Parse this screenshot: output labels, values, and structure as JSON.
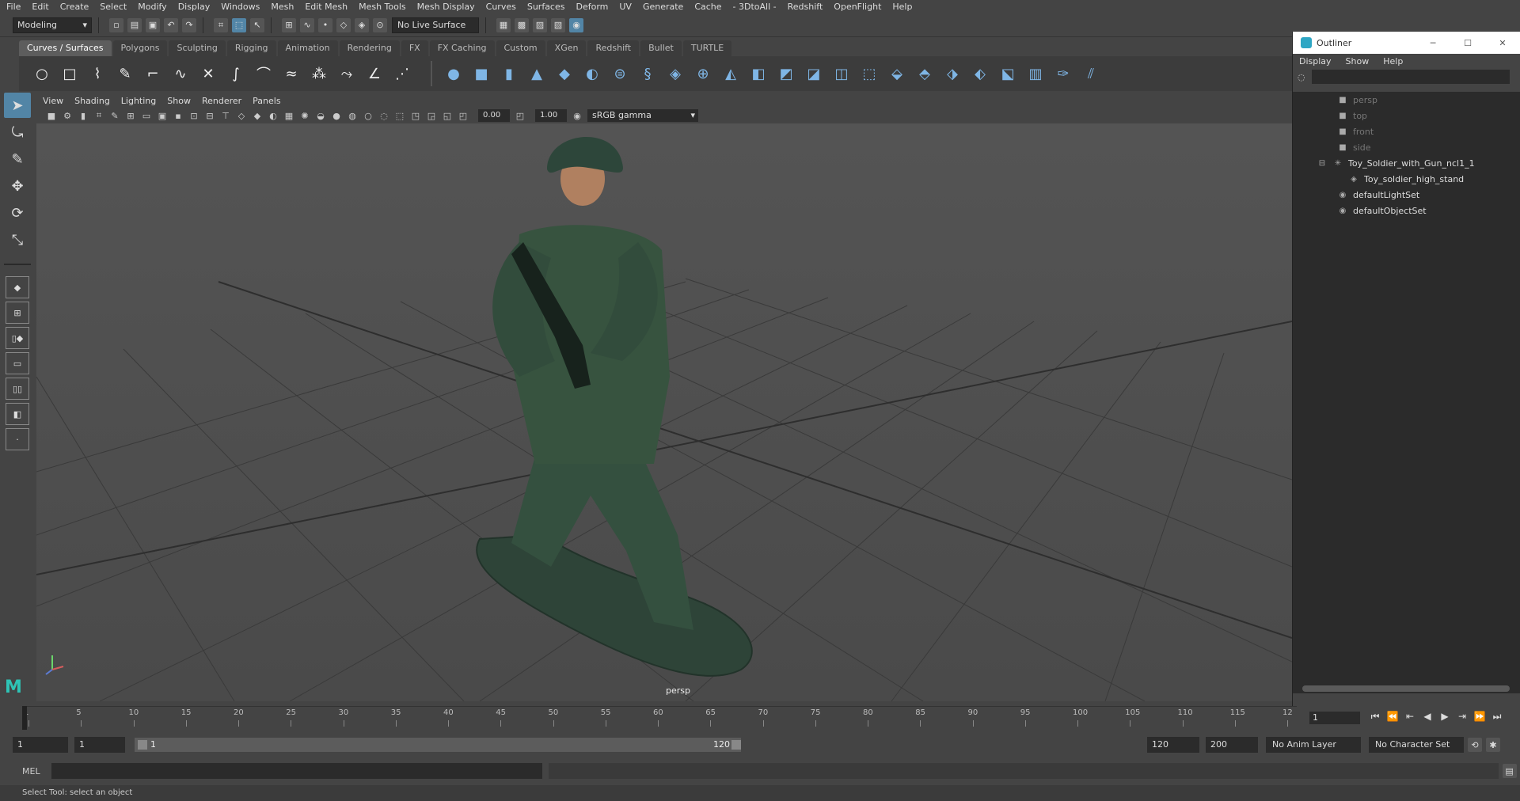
{
  "menubar": [
    "File",
    "Edit",
    "Create",
    "Select",
    "Modify",
    "Display",
    "Windows",
    "Mesh",
    "Edit Mesh",
    "Mesh Tools",
    "Mesh Display",
    "Curves",
    "Surfaces",
    "Deform",
    "UV",
    "Generate",
    "Cache",
    "- 3DtoAll -",
    "Redshift",
    "OpenFlight",
    "Help"
  ],
  "statusline": {
    "mode": "Modeling",
    "live_surface": "No Live Surface"
  },
  "shelf_tabs": [
    "Curves / Surfaces",
    "Polygons",
    "Sculpting",
    "Rigging",
    "Animation",
    "Rendering",
    "FX",
    "FX Caching",
    "Custom",
    "XGen",
    "Redshift",
    "Bullet",
    "TURTLE"
  ],
  "active_shelf": "Curves / Surfaces",
  "panel_menu": [
    "View",
    "Shading",
    "Lighting",
    "Show",
    "Renderer",
    "Panels"
  ],
  "panel_toolbar": {
    "exposure": "0.00",
    "gamma": "1.00",
    "color_space": "sRGB gamma"
  },
  "viewport": {
    "camera_label": "persp"
  },
  "outliner": {
    "title": "Outliner",
    "menu": [
      "Display",
      "Show",
      "Help"
    ],
    "items": [
      {
        "label": "persp",
        "icon": "camera-icon",
        "dim": true
      },
      {
        "label": "top",
        "icon": "camera-icon",
        "dim": true
      },
      {
        "label": "front",
        "icon": "camera-icon",
        "dim": true
      },
      {
        "label": "side",
        "icon": "camera-icon",
        "dim": true
      },
      {
        "label": "Toy_Soldier_with_Gun_ncl1_1",
        "icon": "group-icon",
        "dim": false
      },
      {
        "label": "Toy_soldier_high_stand",
        "icon": "mesh-icon",
        "dim": false
      },
      {
        "label": "defaultLightSet",
        "icon": "set-icon",
        "dim": false
      },
      {
        "label": "defaultObjectSet",
        "icon": "set-icon",
        "dim": false
      }
    ]
  },
  "timeslider": {
    "ticks": [
      "1",
      "5",
      "10",
      "15",
      "20",
      "25",
      "30",
      "35",
      "40",
      "45",
      "50",
      "55",
      "60",
      "65",
      "70",
      "75",
      "80",
      "85",
      "90",
      "95",
      "100",
      "105",
      "110",
      "115",
      "12"
    ],
    "current_frame": "1"
  },
  "rangeslider": {
    "start": "1",
    "playback_start": "1",
    "bar_start": "1",
    "bar_end": "120",
    "playback_end": "120",
    "end": "200",
    "anim_layer": "No Anim Layer",
    "character_set": "No Character Set"
  },
  "cmdline": {
    "label": "MEL"
  },
  "helpline": "Select Tool: select an object",
  "colors": {
    "accent": "#5285a6",
    "soldier": "#2f4a3c",
    "background": "#444444"
  }
}
